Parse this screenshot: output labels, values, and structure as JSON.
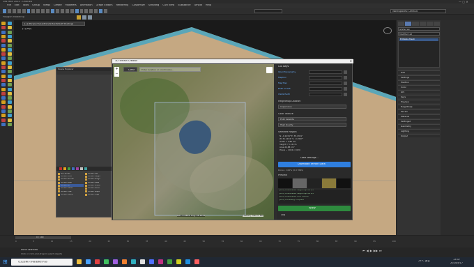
{
  "app": {
    "title": "3ds Max 2024 - Untitled",
    "menu": [
      "File",
      "Edit",
      "Tools",
      "Group",
      "Views",
      "Create",
      "Modifiers",
      "Animation",
      "Graph Editors",
      "Rendering",
      "Customize",
      "Scripting",
      "Civil View",
      "Substance",
      "Arnold",
      "Help"
    ],
    "workspace": "Workspaces: Default"
  },
  "viewport": {
    "label": "[+] [Perspective] [Standard] [Default Shading]",
    "small_label": "[+] [Top]"
  },
  "gis_window": {
    "title": "3D Terrain Creator",
    "clear_button": "Clear",
    "search_placeholder": "Enter location or coordinates...",
    "map_coords": "Lat: -1.2345, Lng: 33.1234",
    "map_attribution": "Leaflet | Tiles © Esri",
    "sidebar": {
      "section_gis": "GIS Keys",
      "key_labels": [
        "OpenTopography",
        "Mapbox",
        "MapTiler",
        "ESRI ArcGIS",
        "USGS Earth"
      ],
      "section_heightmap": "Heightmap Dataset",
      "heightmap_value": "Copernicus",
      "section_color": "Color Texture",
      "color_value": "ESRI Satellite",
      "quality_value": "High Quality",
      "section_region": "Selected Region",
      "region_lines": [
        "N: -0.1234° E: 35.4321°",
        "W: 31.1234° S: -3.4567°",
        "width = 4.86 km",
        "height = 5.12 km",
        "Area 24.88 km²",
        "Pixels ~ 1024 x 1024"
      ],
      "load_settings": "Load Settings...",
      "download_button": "Download Terrain Data",
      "status_line": "Done • 100% (0.0 MB/s)",
      "section_preview": "Preview",
      "log_lines": [
        "[INFO] Downloaded heightmap tile 1/4",
        "[INFO] Downloaded heightmap tile 2/4",
        "[INFO] Downloaded color texture",
        "[INFO] Processing complete"
      ],
      "apply_button": "Apply",
      "log_label": "Log"
    }
  },
  "small_window": {
    "title": "Scene Explorer",
    "list_items": [
      "GIS Terrain",
      "Terrain Mat",
      "Terrain Color",
      "Terrain Height",
      "Terrain Normal",
      "Terrain Rough",
      "Terrain Displ",
      "Terrain Mask",
      "Terrain AO",
      "Terrain Shade",
      "Terrain Detail",
      "Terrain Blend",
      "Terrain Flow",
      "Terrain Slope",
      "Terrain Cavity",
      "Terrain Edge"
    ]
  },
  "command_panel": {
    "object_name": "GISTerrain",
    "modifier_list": "Modifier List",
    "stack_item": "Editable Mesh",
    "rollouts": [
      "Edit",
      "Settings",
      "Position",
      "Color",
      "GIS",
      "Keys",
      "Preview",
      "Heightmap",
      "Terrain",
      "Material",
      "Settings2",
      "Geometry",
      "Lighting",
      "Output"
    ]
  },
  "timeline": {
    "frame": "0 / 100",
    "status": "None Selected",
    "prompt": "Click or click-and-drag to select objects",
    "ticks": [
      "0",
      "5",
      "10",
      "15",
      "20",
      "25",
      "30",
      "35",
      "40",
      "45",
      "50",
      "55",
      "60",
      "65",
      "70",
      "75",
      "80",
      "85",
      "90",
      "95",
      "100"
    ]
  },
  "taskbar": {
    "search_placeholder": "在这里输入你要搜索的内容",
    "weather": "23°C 多云",
    "time": "13:47",
    "date": "2024/5/17"
  }
}
